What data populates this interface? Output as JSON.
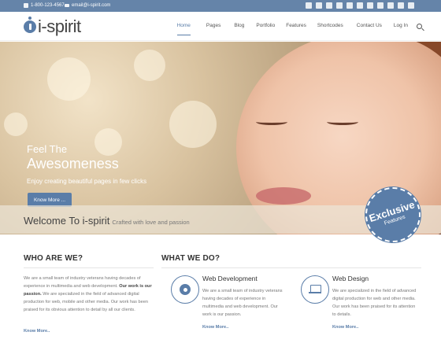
{
  "topbar": {
    "phone": "1-800-123-4567",
    "email": "email@i-spirit.com",
    "social_icons": [
      "twitter-icon",
      "facebook-icon",
      "skype-icon",
      "google-plus-icon",
      "linkedin-icon",
      "youtube-icon",
      "flickr-icon",
      "vimeo-icon",
      "instagram-icon",
      "pinterest-icon",
      "rss-icon"
    ]
  },
  "header": {
    "logo": "i-spirit",
    "nav": [
      "Home",
      "Pages",
      "Blog",
      "Portfolio",
      "Features",
      "Shortcodes",
      "Contact Us",
      "Log In"
    ],
    "active_nav": "Home"
  },
  "hero": {
    "kicker": "Feel The",
    "title": "Awesomeness",
    "subtitle": "Enjoy creating beautiful pages in few clicks",
    "button": "Know More ...",
    "slides": 3,
    "active_slide": 1
  },
  "welcome": {
    "title": "Welcome To i-spirit",
    "tagline": "Crafted with love and passion"
  },
  "badge": {
    "line1": "Exclusive",
    "line2": "Features"
  },
  "who": {
    "title": "WHO ARE WE?",
    "text_start": "We are a small team of industry veterans having decades of experience in multimedia and web development.",
    "text_bold": "Our work is our passion.",
    "text_end": "We are specialized in the field of advanced digital production for web, mobile and other media. Our work has been praised for its obvious attention to detail by all our clients.",
    "link": "Know More.."
  },
  "what": {
    "title": "WHAT WE DO?",
    "services": [
      {
        "title": "Web Development",
        "text": "We are a small team of industry veterans having decades of experience in multimedia and web development. Our work is our passion.",
        "link": "Know More..",
        "icon": "gear-icon"
      },
      {
        "title": "Web Design",
        "text": "We are specialized in the field of advanced digital production for web and other media. Our work has been praised for its attention to details.",
        "link": "Know More..",
        "icon": "laptop-icon"
      }
    ]
  },
  "colors": {
    "accent": "#5a7da8",
    "topbar": "#6584a9"
  }
}
